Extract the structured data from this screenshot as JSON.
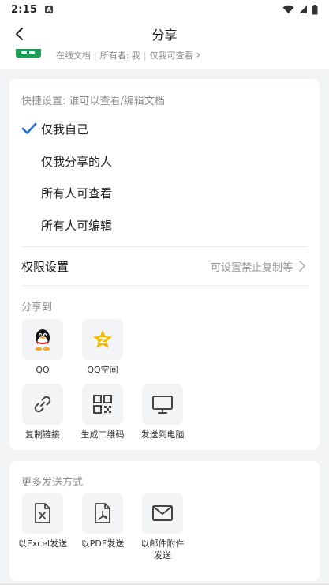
{
  "status_bar": {
    "time": "2:15",
    "notif_glyph": "A"
  },
  "header": {
    "title": "分享"
  },
  "doc": {
    "type": "在线文档",
    "owner": "所有者: 我",
    "permission": "仅我可查看",
    "chevron": "›"
  },
  "quick_settings": {
    "label": "快捷设置: 谁可以查看/编辑文档",
    "options": [
      {
        "label": "仅我自己",
        "selected": true
      },
      {
        "label": "仅我分享的人",
        "selected": false
      },
      {
        "label": "所有人可查看",
        "selected": false
      },
      {
        "label": "所有人可编辑",
        "selected": false
      }
    ]
  },
  "permissions": {
    "title": "权限设置",
    "value": "可设置禁止复制等"
  },
  "share_to": {
    "label": "分享到",
    "items": [
      {
        "label": "QQ",
        "icon": "qq-icon"
      },
      {
        "label": "QQ空间",
        "icon": "qzone-icon"
      },
      {
        "label": "复制链接",
        "icon": "link-icon"
      },
      {
        "label": "生成二维码",
        "icon": "qrcode-icon"
      },
      {
        "label": "发送到电脑",
        "icon": "monitor-icon"
      }
    ]
  },
  "more_send": {
    "label": "更多发送方式",
    "items": [
      {
        "label": "以Excel发送",
        "icon": "excel-icon"
      },
      {
        "label": "以PDF发送",
        "icon": "pdf-icon"
      },
      {
        "label": "以邮件附件发送",
        "icon": "mail-icon"
      }
    ]
  },
  "colors": {
    "accent": "#1f6fd6",
    "qzone_yellow": "#f6b800",
    "sheet_green": "#1f9d55"
  }
}
